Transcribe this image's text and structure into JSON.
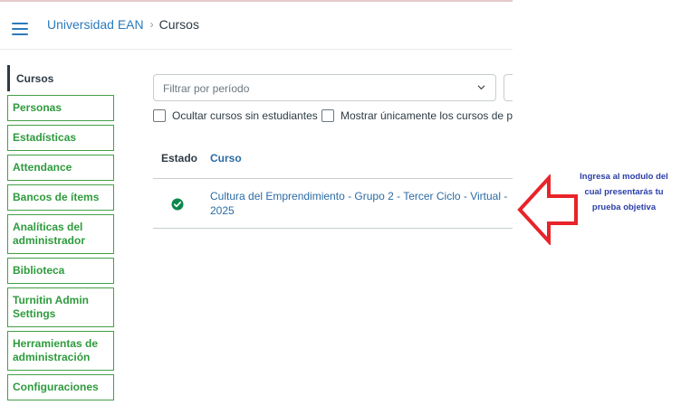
{
  "breadcrumb": {
    "root": "Universidad EAN",
    "separator": "›",
    "current": "Cursos"
  },
  "sidebar": {
    "active": "Cursos",
    "items": [
      {
        "label": "Personas"
      },
      {
        "label": "Estadísticas"
      },
      {
        "label": "Attendance"
      },
      {
        "label": "Bancos de ítems"
      },
      {
        "label": "Analíticas del administrador"
      },
      {
        "label": "Biblioteca"
      },
      {
        "label": "Turnitin Admin Settings"
      },
      {
        "label": "Herramientas de administración"
      },
      {
        "label": "Configuraciones"
      }
    ]
  },
  "filters": {
    "period_placeholder": "Filtrar por período",
    "hide_without_students": "Ocultar cursos sin estudiantes",
    "show_only_prefix": "Mostrar únicamente los cursos de pr"
  },
  "table": {
    "columns": [
      "Estado",
      "Curso"
    ],
    "rows": [
      {
        "status": "published",
        "course": "Cultura del Emprendimiento - Grupo 2 - Tercer Ciclo - Virtual - 2025"
      }
    ]
  },
  "annotation": {
    "text": "Ingresa al modulo del cual presentarás tu prueba objetiva"
  },
  "colors": {
    "link": "#2b7abc",
    "sidebar_green": "#43a047",
    "status_green": "#0b874b",
    "arrow_red": "#e8232a",
    "annotation_blue": "#2a3ea8"
  },
  "icons": [
    "hamburger-menu-icon",
    "chevron-down-icon",
    "published-check-icon",
    "red-arrow-left-icon"
  ]
}
